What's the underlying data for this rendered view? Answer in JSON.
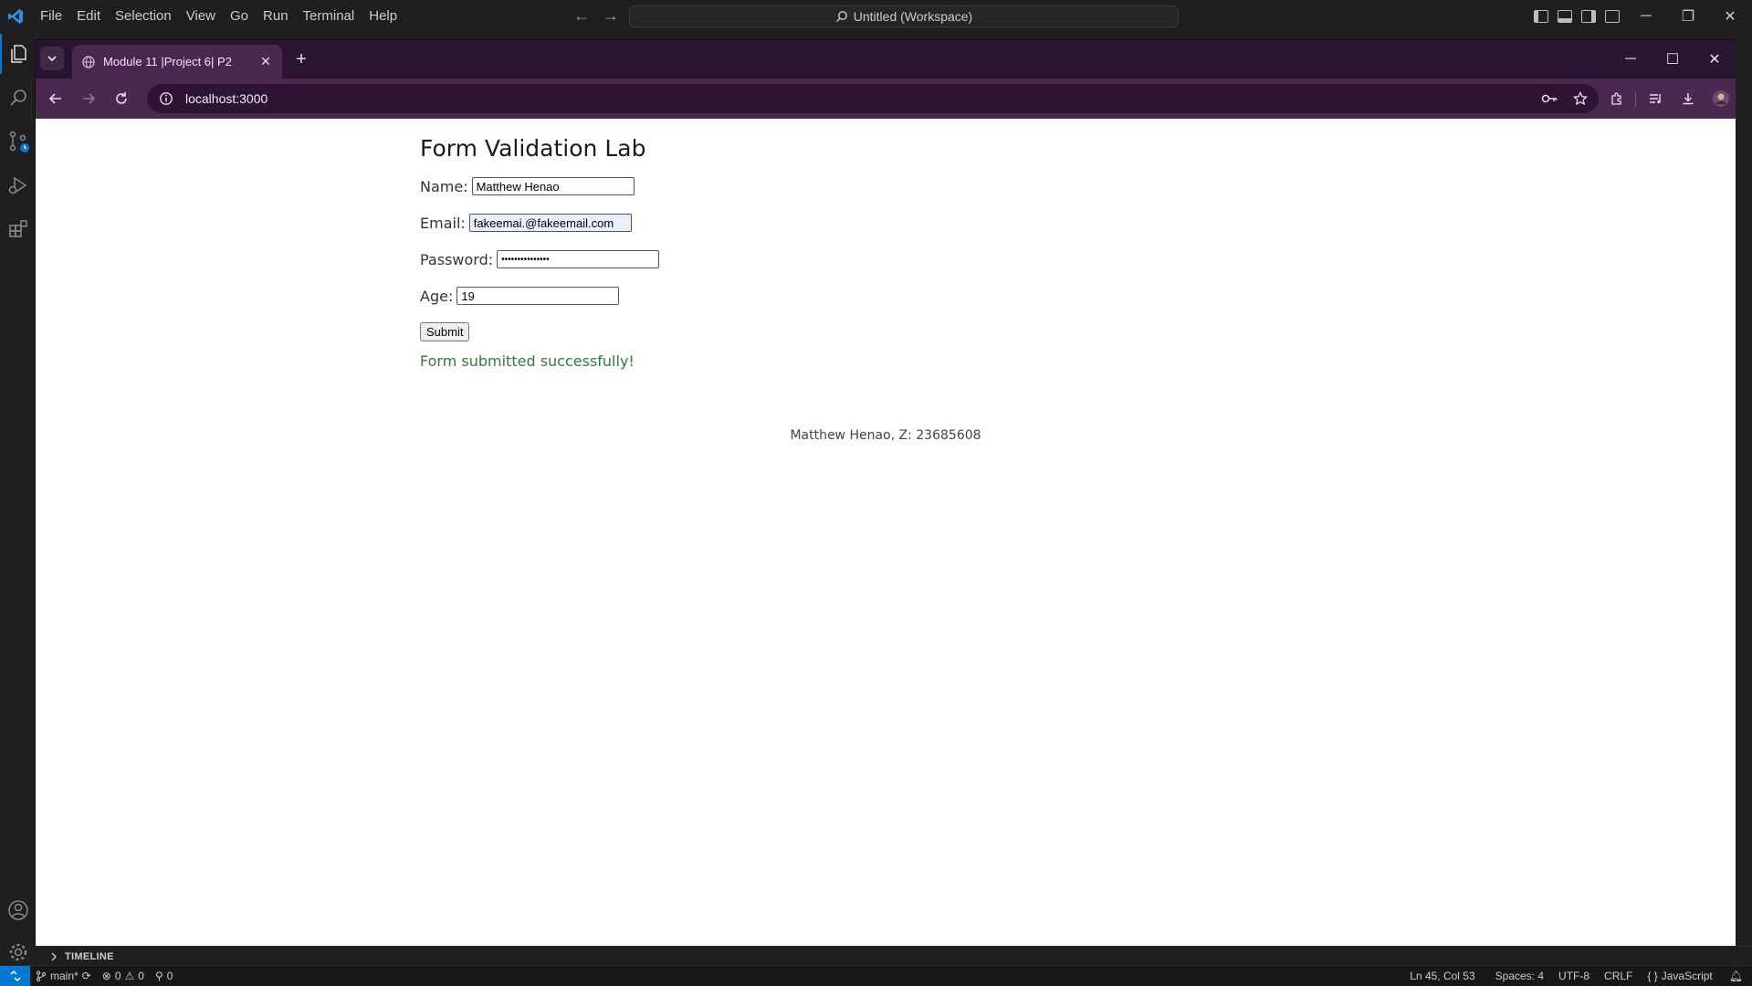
{
  "vscode": {
    "menu": [
      "File",
      "Edit",
      "Selection",
      "View",
      "Go",
      "Run",
      "Terminal",
      "Help"
    ],
    "command_center": "Untitled (Workspace)",
    "accent_color": "#0078d4"
  },
  "browser": {
    "tab_title": "Module 11 |Project 6| P2",
    "url": "localhost:3000",
    "theme_color": "#4a2850"
  },
  "page": {
    "title": "Form Validation Lab",
    "fields": {
      "name_label": "Name:",
      "name_value": "Matthew Henao",
      "email_label": "Email:",
      "email_value": "fakeemai.@fakeemail.com",
      "password_label": "Password:",
      "password_value": "•••••••••••••••",
      "age_label": "Age:",
      "age_value": "19"
    },
    "submit_label": "Submit",
    "success_message": "Form submitted successfully!",
    "success_color": "#2e7d32",
    "footer": "Matthew Henao, Z: 23685608"
  },
  "panel": {
    "timeline_label": "TIMELINE"
  },
  "statusbar": {
    "branch": "main*",
    "errors": "0",
    "warnings": "0",
    "ports": "0",
    "cursor": "Ln 45, Col 53",
    "indent": "Spaces: 4",
    "encoding": "UTF-8",
    "eol": "CRLF",
    "language": "JavaScript"
  }
}
